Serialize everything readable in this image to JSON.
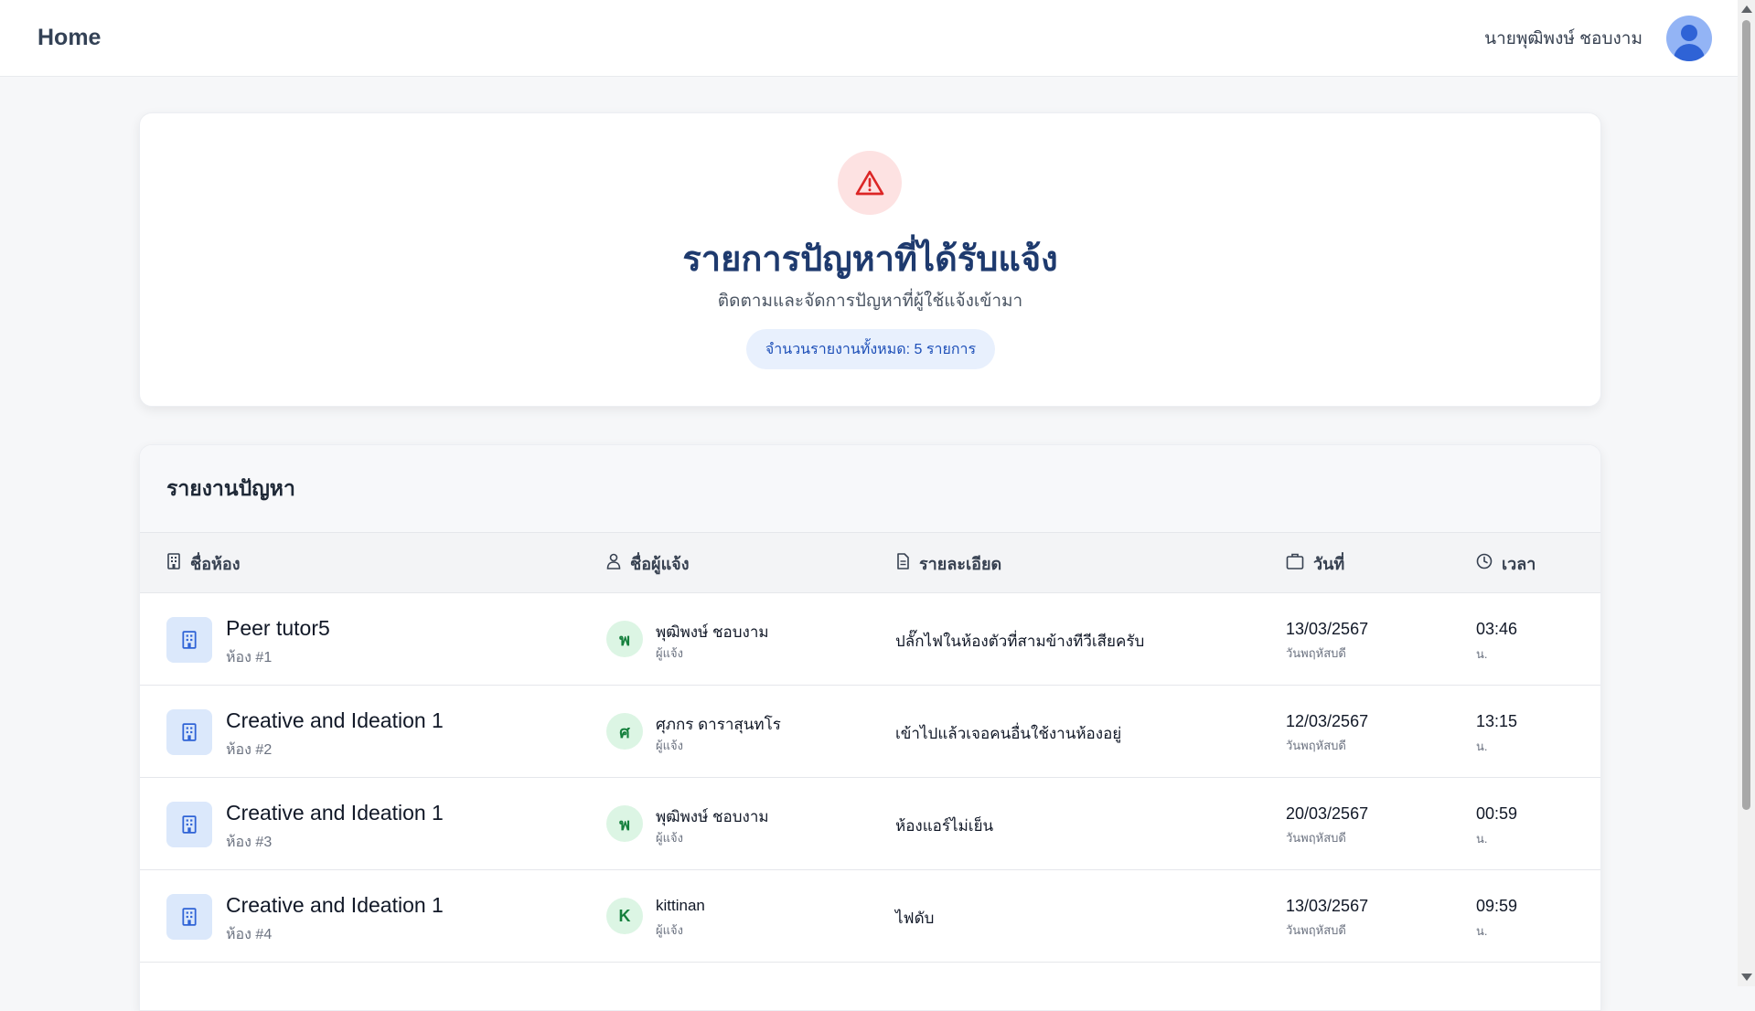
{
  "topbar": {
    "brand": "Home",
    "user_name": "นายพุฒิพงษ์ ชอบงาม"
  },
  "hero": {
    "title": "รายการปัญหาที่ได้รับแจ้ง",
    "subtitle": "ติดตามและจัดการปัญหาที่ผู้ใช้แจ้งเข้ามา",
    "count_label": "จำนวนรายงานทั้งหมด: 5 รายการ"
  },
  "report": {
    "title": "รายงานปัญหา",
    "columns": {
      "room": "ชื่อห้อง",
      "reporter": "ชื่อผู้แจ้ง",
      "detail": "รายละเอียด",
      "date": "วันที่",
      "time": "เวลา"
    },
    "rows": [
      {
        "room_name": "Peer tutor5",
        "room_no": "ห้อง #1",
        "initial": "พ",
        "reporter": "พุฒิพงษ์ ชอบงาม",
        "role": "ผู้แจ้ง",
        "detail": "ปลั๊กไฟในห้องตัวที่สามข้างทีวีเสียครับ",
        "date": "13/03/2567",
        "day": "วันพฤหัสบดี",
        "time": "03:46",
        "time_unit": "น."
      },
      {
        "room_name": "Creative and Ideation 1",
        "room_no": "ห้อง #2",
        "initial": "ศ",
        "reporter": "ศุภกร ดาราสุนทโร",
        "role": "ผู้แจ้ง",
        "detail": "เข้าไปแล้วเจอคนอื่นใช้งานห้องอยู่",
        "date": "12/03/2567",
        "day": "วันพฤหัสบดี",
        "time": "13:15",
        "time_unit": "น."
      },
      {
        "room_name": "Creative and Ideation 1",
        "room_no": "ห้อง #3",
        "initial": "พ",
        "reporter": "พุฒิพงษ์ ชอบงาม",
        "role": "ผู้แจ้ง",
        "detail": "ห้องแอร์ไม่เย็น",
        "date": "20/03/2567",
        "day": "วันพฤหัสบดี",
        "time": "00:59",
        "time_unit": "น."
      },
      {
        "room_name": "Creative and Ideation 1",
        "room_no": "ห้อง #4",
        "initial": "K",
        "reporter": "kittinan",
        "role": "ผู้แจ้ง",
        "detail": "ไฟดับ",
        "date": "13/03/2567",
        "day": "วันพฤหัสบดี",
        "time": "09:59",
        "time_unit": "น."
      }
    ]
  },
  "colors": {
    "title": "#1e3a6e",
    "warning": "#dc2626",
    "accent": "#1d4fb8",
    "avatar_bg": "#dcf5e4"
  },
  "icons": {
    "warning": "warning-triangle-icon",
    "building": "building-icon",
    "user": "user-icon",
    "document": "document-icon",
    "calendar": "calendar-icon",
    "clock": "clock-icon"
  }
}
